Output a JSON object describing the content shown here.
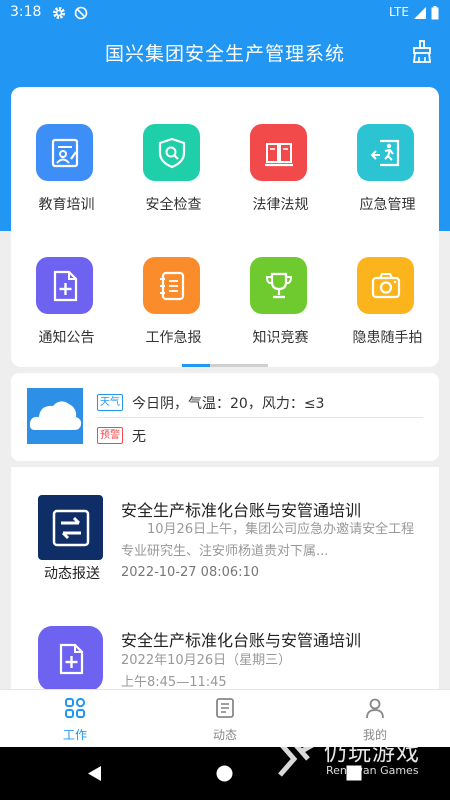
{
  "status_bar": {
    "time": "3:18",
    "network": "LTE",
    "icons": [
      "gear-icon",
      "sync-off-icon",
      "signal-icon",
      "battery-icon"
    ]
  },
  "header": {
    "title": "国兴集团安全生产管理系统",
    "action_icon": "broom-icon"
  },
  "grid": {
    "items": [
      {
        "label": "教育培训",
        "icon": "training-icon",
        "color": "#3e8ef7"
      },
      {
        "label": "安全检查",
        "icon": "shield-search-icon",
        "color": "#1fcfa9"
      },
      {
        "label": "法律法规",
        "icon": "book-icon",
        "color": "#f24a4a"
      },
      {
        "label": "应急管理",
        "icon": "emergency-exit-icon",
        "color": "#2cc3d3"
      },
      {
        "label": "通知公告",
        "icon": "document-add-icon",
        "color": "#6d63f0"
      },
      {
        "label": "工作急报",
        "icon": "notepad-icon",
        "color": "#fb8c2b"
      },
      {
        "label": "知识竞赛",
        "icon": "trophy-icon",
        "color": "#6fca2f"
      },
      {
        "label": "隐患随手拍",
        "icon": "camera-icon",
        "color": "#fcb41d"
      }
    ],
    "active_page": 1,
    "page_count": 2
  },
  "weather": {
    "weather_tag": "天气",
    "weather_text": "今日阴，气温：20，风力：≤3",
    "warning_tag": "预警",
    "warning_text": "无",
    "icon": "cloud-icon"
  },
  "news": [
    {
      "title": "安全生产标准化台账与安管通培训",
      "desc": "　　10月26日上午，集团公司应急办邀请安全工程专业研究生、注安师杨道贵对下属...",
      "date": "2022-10-27 08:06:10",
      "thumb_label": "动态报送",
      "thumb_icon": "sync-icon",
      "thumb_color": "#0f2d66"
    },
    {
      "title": "安全生产标准化台账与安管通培训",
      "desc": "2022年10月26日（星期三）\n上午8:45—11:45",
      "date": "",
      "thumb_label": "",
      "thumb_icon": "document-add-icon",
      "thumb_color": "#6d63f0"
    }
  ],
  "tab_bar": {
    "tabs": [
      {
        "label": "工作",
        "icon": "grid-icon",
        "active": true
      },
      {
        "label": "动态",
        "icon": "news-icon",
        "active": false
      },
      {
        "label": "我的",
        "icon": "user-icon",
        "active": false
      }
    ],
    "active_color": "#2196f3",
    "inactive_color": "#888888"
  },
  "watermark": {
    "cn": "仍玩游戏",
    "en": "Rengwan Games"
  },
  "colors": {
    "primary": "#2196f3",
    "background": "#eeeeee",
    "warning_tag": "#f24a4a",
    "weather_tag": "#2196f3"
  }
}
